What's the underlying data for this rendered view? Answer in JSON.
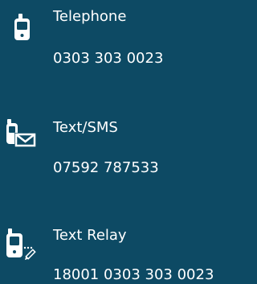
{
  "contacts": {
    "telephone": {
      "icon": "mobile-phone-icon",
      "label": "Telephone",
      "value": "0303 303 0023"
    },
    "text": {
      "icon": "phone-with-envelope-icon",
      "label": "Text/SMS",
      "value": "07592 787533"
    },
    "relay": {
      "icon": "phone-with-pencil-icon",
      "label": "Text Relay",
      "value": "18001 0303 303 0023"
    }
  },
  "colors": {
    "background": "#0d4a64",
    "text": "#ffffff"
  }
}
